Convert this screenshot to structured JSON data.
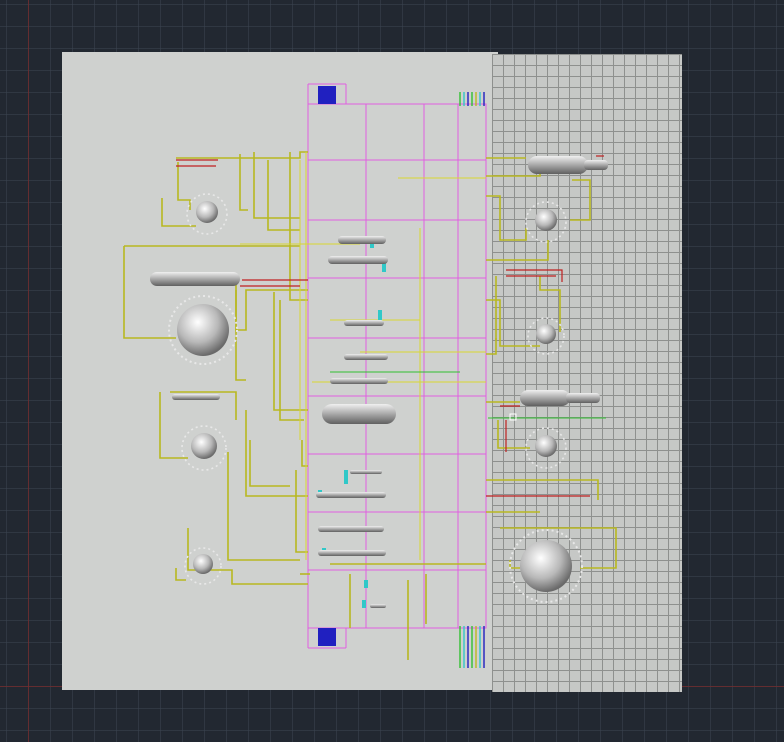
{
  "viewport": {
    "background": "#222831",
    "grid_color": "#3c4450",
    "axis_color": "#7a2a2a"
  },
  "model": {
    "sheet_color": "#cfd1cf",
    "floor_grid_color": "#c6c8c6",
    "structure_color": "#e060e0",
    "pipe_color": "#b8b820",
    "pipe_alt_color": "#d8d830",
    "red_line_color": "#c02020",
    "green_line_color": "#30c030",
    "cyan_color": "#30c8c8",
    "blue_block_color": "#2020c0",
    "equipment_color": "#9a9a9a",
    "equipment": [
      {
        "kind": "horizontal-drum",
        "name": "drum-left-upper"
      },
      {
        "kind": "horizontal-drum",
        "name": "drum-right-top"
      },
      {
        "kind": "horizontal-drum",
        "name": "drum-right-mid"
      },
      {
        "kind": "horizontal-drum",
        "name": "drum-center"
      },
      {
        "kind": "sphere-tank",
        "name": "sphere-large-left"
      },
      {
        "kind": "sphere-tank",
        "name": "sphere-large-right"
      },
      {
        "kind": "pump",
        "name": "pump-left-1"
      },
      {
        "kind": "pump",
        "name": "pump-left-2"
      },
      {
        "kind": "pump",
        "name": "pump-left-3"
      },
      {
        "kind": "pump",
        "name": "pump-right-1"
      },
      {
        "kind": "pump",
        "name": "pump-right-2"
      },
      {
        "kind": "pump",
        "name": "pump-right-3"
      }
    ]
  }
}
